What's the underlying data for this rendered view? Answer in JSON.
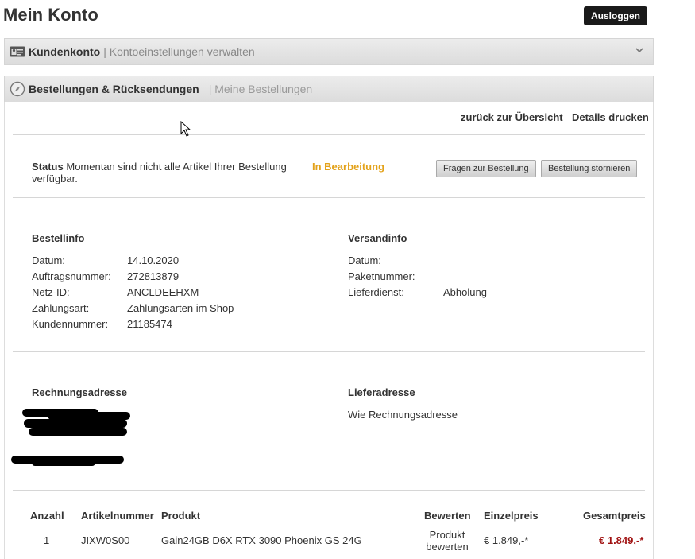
{
  "header": {
    "title": "Mein Konto",
    "logout_label": "Ausloggen"
  },
  "section1": {
    "title": "Kundenkonto",
    "subtitle": "| Kontoeinstellungen verwalten"
  },
  "section2": {
    "title": "Bestellungen & Rücksendungen",
    "subtitle": "| Meine Bestellungen"
  },
  "links": {
    "back": "zurück zur Übersicht",
    "print": "Details drucken"
  },
  "status": {
    "label": "Status",
    "message": "Momentan sind nicht alle Artikel Ihrer Bestellung verfügbar.",
    "value": "In Bearbeitung",
    "color": "#e3a21a",
    "question_button": "Fragen zur Bestellung",
    "cancel_button": "Bestellung stornieren"
  },
  "order_info": {
    "heading": "Bestellinfo",
    "rows": [
      {
        "key": "Datum:",
        "value": "14.10.2020"
      },
      {
        "key": "Auftragsnummer:",
        "value": "272813879"
      },
      {
        "key": "Netz-ID:",
        "value": "ANCLDEEHXM"
      },
      {
        "key": "Zahlungsart:",
        "value": "Zahlungsarten im Shop"
      },
      {
        "key": "Kundennummer:",
        "value": "21185474"
      }
    ]
  },
  "shipping_info": {
    "heading": "Versandinfo",
    "rows": [
      {
        "key": "Datum:",
        "value": ""
      },
      {
        "key": "Paketnummer:",
        "value": ""
      },
      {
        "key": "Lieferdienst:",
        "value": "Abholung"
      }
    ]
  },
  "addresses": {
    "billing_heading": "Rechnungsadresse",
    "delivery_heading": "Lieferadresse",
    "delivery_text": "Wie Rechnungsadresse"
  },
  "table": {
    "headers": [
      "Anzahl",
      "Artikelnummer",
      "Produkt",
      "Bewerten",
      "Einzelpreis",
      "Gesamtpreis"
    ],
    "rows": [
      {
        "qty": "1",
        "article": "JIXW0S00",
        "product": "Gain24GB D6X RTX 3090 Phoenix GS 24G",
        "rate_line1": "Produkt",
        "rate_line2": "bewerten",
        "unit_price": "€ 1.849,-*",
        "total_price": "€ 1.849,-*"
      }
    ]
  },
  "colors": {
    "accent_status": "#e3a21a",
    "price_red": "#a01010"
  }
}
